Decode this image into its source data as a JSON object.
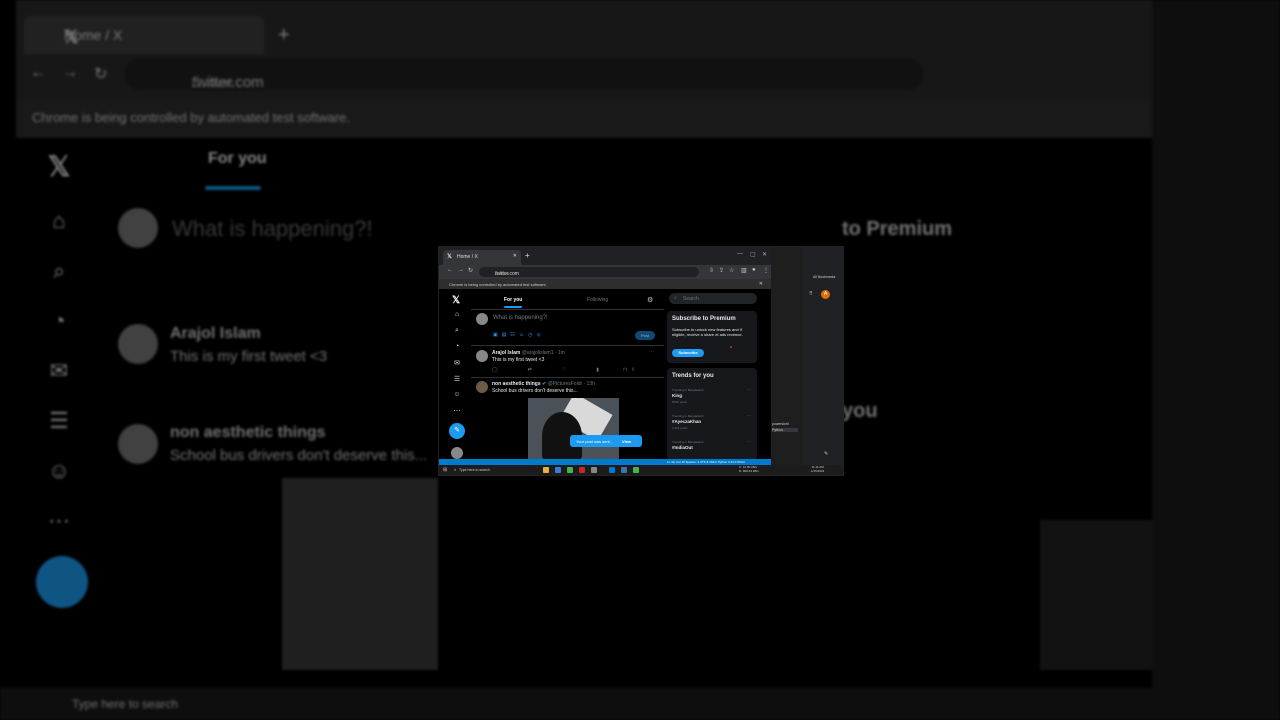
{
  "browser": {
    "tab_title": "Home / X",
    "url_domain": "twitter.com",
    "url_path": "/home",
    "automation_notice": "Chrome is being controlled by automated test software."
  },
  "twitter": {
    "tabs": {
      "for_you": "For you",
      "following": "Following"
    },
    "composer_placeholder": "What is happening?!",
    "post_button": "Post",
    "tweets": [
      {
        "name": "Arajol Islam",
        "handle": "@arajolislam1 · 1m",
        "text": "This is my first tweet <3"
      },
      {
        "name": "non aesthetic things",
        "handle": "@PicturesFoldr · 13h",
        "text": "School bus drivers don't deserve this..."
      }
    ],
    "toast": {
      "message": "Your post was sent.",
      "action": "View"
    },
    "search_placeholder": "Search",
    "premium": {
      "title": "Subscribe to Premium",
      "description": "Subscribe to unlock new features and if eligible, receive a share of ads revenue.",
      "button": "Subscribe"
    },
    "trends_title": "Trends for you",
    "trends": [
      {
        "context": "Trending in Bangladesh",
        "name": "King",
        "count": "875K posts"
      },
      {
        "context": "Trending in Bangladesh",
        "name": "#AyeczaKhan",
        "count": "3,451 posts"
      },
      {
        "context": "Trending in Bangladesh",
        "name": "#IndiaOut",
        "count": ""
      }
    ]
  },
  "side_apps": {
    "all_bookmarks": "All Bookmarks",
    "avatar_letter": "A",
    "terminals": [
      "powershell",
      "Python"
    ]
  },
  "vscode_status": {
    "text": "Ln 44, Col 16   Spaces: 4   UTF-8   CRLF   Python   3.12.0 64-bit",
    "spaces": "Spaces: 4",
    "encoding": "UTF-8",
    "eol": "CRLF",
    "language": "Python",
    "interpreter": "3.12.0 64-bit"
  },
  "taskbar": {
    "search_placeholder": "Type here to search",
    "net_up": "10.80 kB/s",
    "net_down": "899.63 kB/s",
    "net_up_label": "U:",
    "net_down_label": "D:",
    "time": "11:11 AM",
    "date": "1/15/2024"
  },
  "colors": {
    "accent": "#1d9bf0",
    "background": "#000000",
    "card": "#16181c",
    "text": "#e7e9ea",
    "muted": "#71767b"
  },
  "icons": [
    "x-logo-icon",
    "home-icon",
    "search-icon",
    "bell-icon",
    "mail-icon",
    "list-icon",
    "person-icon",
    "more-icon",
    "compose-icon",
    "gear-icon",
    "reply-icon",
    "retweet-icon",
    "like-icon",
    "views-icon",
    "bookmark-icon",
    "share-icon"
  ]
}
